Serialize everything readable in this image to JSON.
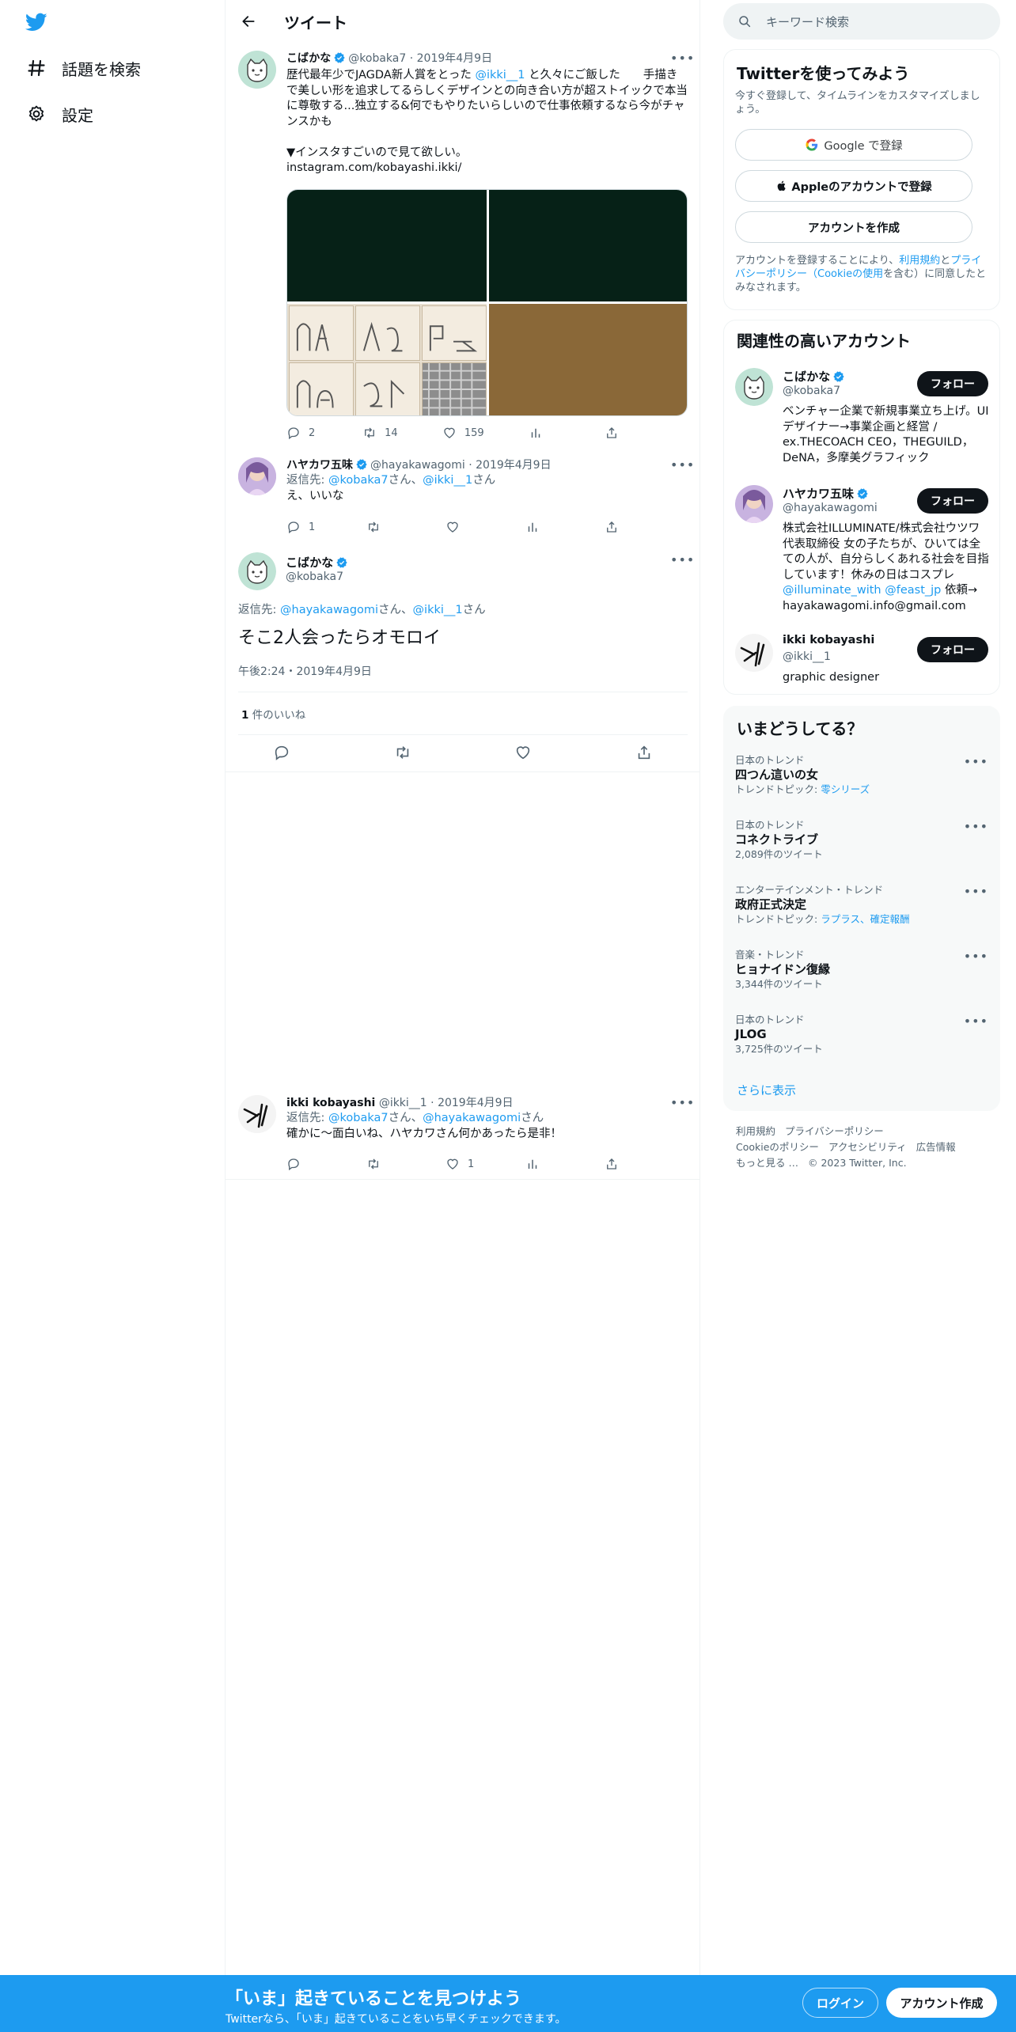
{
  "nav": {
    "logo": "twitter-bird-icon",
    "items": [
      {
        "label": "話題を検索",
        "icon": "hashtag-icon"
      },
      {
        "label": "設定",
        "icon": "gear-icon"
      }
    ]
  },
  "header": {
    "title": "ツイート",
    "back_icon": "back-arrow-icon"
  },
  "tweets": {
    "t1": {
      "name": "こばかな",
      "handle": "@kobaka7",
      "date": "2019年4月9日",
      "text_before": "歴代最年少でJAGDA新人賞をとった ",
      "mention": "@ikki__1",
      "text_after": " と久々にご飯した　　手描きで美しい形を追求してるらしくデザインとの向き合い方が超ストイックで本当に尊敬する...独立する&何でもやりたいらしいので仕事依頼するなら今がチャンスかも\n\n▼インスタすごいので見て欲しい。",
      "link": "instagram.com/kobayashi.ikki/",
      "counts": {
        "reply": "2",
        "retweet": "14",
        "like": "159"
      }
    },
    "t2": {
      "name": "ハヤカワ五味",
      "handle": "@hayakawagomi",
      "date": "2019年4月9日",
      "reply_label": "返信先: ",
      "reply_m1": "@kobaka7",
      "reply_mid": "さん、",
      "reply_m2": "@ikki__1",
      "reply_end": "さん",
      "text": "え、いいな",
      "counts": {
        "reply": "1",
        "retweet": "",
        "like": ""
      }
    },
    "focus": {
      "name": "こばかな",
      "handle": "@kobaka7",
      "reply_label": "返信先: ",
      "reply_m1": "@hayakawagomi",
      "reply_mid": "さん、",
      "reply_m2": "@ikki__1",
      "reply_end": "さん",
      "text": "そこ2人会ったらオモロイ",
      "time": "午後2:24・2019年4月9日",
      "likes_count": "1",
      "likes_label": " 件のいいね"
    },
    "t3": {
      "name": "ikki kobayashi",
      "handle": "@ikki__1",
      "date": "2019年4月9日",
      "reply_label": "返信先: ",
      "reply_m1": "@kobaka7",
      "reply_mid": "さん、",
      "reply_m2": "@hayakawagomi",
      "reply_end": "さん",
      "text": "確かに〜面白いね、ハヤカワさん何かあったら是非！",
      "counts": {
        "reply": "",
        "retweet": "",
        "like": "1"
      }
    }
  },
  "search": {
    "placeholder": "キーワード検索"
  },
  "signup_card": {
    "title": "Twitterを使ってみよう",
    "subtitle": "今すぐ登録して、タイムラインをカスタマイズしましょう。",
    "google": "Google で登録",
    "apple": "Appleのアカウントで登録",
    "create": "アカウントを作成",
    "note_1": "アカウントを登録することにより、",
    "note_terms": "利用規約",
    "note_2": "と",
    "note_privacy": "プライバシーポリシー（Cookieの使用",
    "note_3": "を含む）に同意したとみなされます。"
  },
  "related": {
    "title": "関連性の高いアカウント",
    "follow": "フォロー",
    "accounts": [
      {
        "name": "こばかな",
        "handle": "@kobaka7",
        "bio": "ベンチャー企業で新規事業立ち上げ。UIデザイナー→事業企画と経営 / ex.THECOACH CEO，THEGUILD，DeNA，多摩美グラフィック"
      },
      {
        "name": "ハヤカワ五味",
        "handle": "@hayakawagomi",
        "bio_1": "株式会社ILLUMINATE/株式会社ウツワ 代表取締役 女の子たちが、ひいては全ての人が、自分らしくあれる社会を目指しています！休みの日はコスプレ ",
        "bio_m1": "@illuminate_with",
        "bio_2": " ",
        "bio_m2": "@feast_jp",
        "bio_3": " 依頼→ hayakawagomi.info@gmail.com"
      },
      {
        "name": "ikki kobayashi",
        "handle": "@ikki__1",
        "bio": "graphic designer"
      }
    ]
  },
  "trends": {
    "title": "いまどうしてる？",
    "items": [
      {
        "meta": "日本のトレンド",
        "title": "四つん這いの女",
        "sub_label": "トレンドトピック: ",
        "sub_link": "零シリーズ"
      },
      {
        "meta": "日本のトレンド",
        "title": "コネクトライブ",
        "sub": "2,089件のツイート"
      },
      {
        "meta": "エンターテインメント・トレンド",
        "title": "政府正式決定",
        "sub_label": "トレンドトピック: ",
        "sub_link": "ラプラス、確定報酬"
      },
      {
        "meta": "音楽・トレンド",
        "title": "ヒョナイドン復縁",
        "sub": "3,344件のツイート"
      },
      {
        "meta": "日本のトレンド",
        "title": "JLOG",
        "sub": "3,725件のツイート"
      }
    ],
    "show_more": "さらに表示"
  },
  "footer": {
    "links": [
      "利用規約",
      "プライバシーポリシー",
      "Cookieのポリシー",
      "アクセシビリティ",
      "広告情報",
      "もっと見る …",
      "© 2023 Twitter, Inc."
    ]
  },
  "bottom_bar": {
    "title": "「いま」起きていることを見つけよう",
    "subtitle": "Twitterなら、「いま」起きていることをいち早くチェックできます。",
    "login": "ログイン",
    "signup": "アカウント作成"
  },
  "colors": {
    "accent": "#1d9bf0",
    "text": "#0f1419",
    "muted": "#536471",
    "border": "#eff3f4"
  }
}
